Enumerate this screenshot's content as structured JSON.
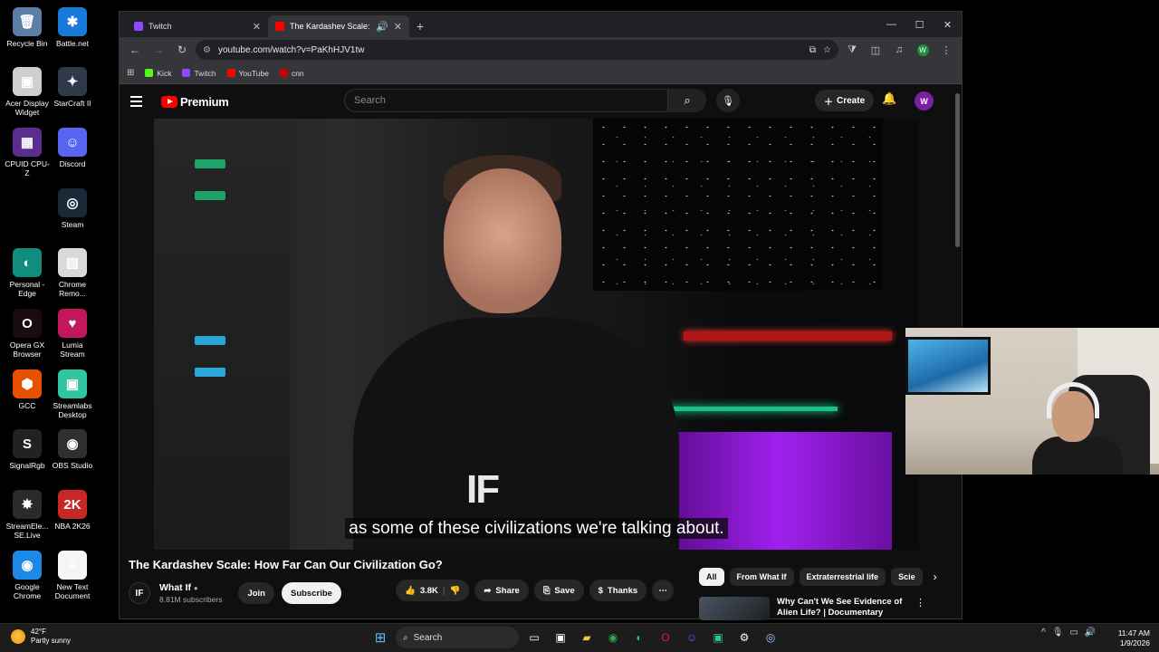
{
  "desktop": {
    "icons": [
      {
        "label": "Recycle Bin",
        "glyph": "🗑",
        "color": "#5a7ea6"
      },
      {
        "label": "Battle.net",
        "glyph": "✱",
        "color": "#1a7ad9"
      },
      {
        "label": "Acer Display Widget",
        "glyph": "▣",
        "color": "#cfcfcf"
      },
      {
        "label": "StarCraft II",
        "glyph": "✦",
        "color": "#2e3a4a"
      },
      {
        "label": "CPUID CPU-Z",
        "glyph": "▦",
        "color": "#5b2d91"
      },
      {
        "label": "Discord",
        "glyph": "☺",
        "color": "#5865f2"
      },
      {
        "label": "Steam",
        "glyph": "◎",
        "color": "#1b2838"
      },
      {
        "label": "Personal - Edge",
        "glyph": "◐",
        "color": "#0f8d7d"
      },
      {
        "label": "Chrome Remo...",
        "glyph": "▤",
        "color": "#d9d9d9"
      },
      {
        "label": "Opera GX Browser",
        "glyph": "O",
        "color": "#1a0a12"
      },
      {
        "label": "Lumia Stream",
        "glyph": "♥",
        "color": "#c2185b"
      },
      {
        "label": "GCC",
        "glyph": "⬢",
        "color": "#e65100"
      },
      {
        "label": "Streamlabs Desktop",
        "glyph": "▣",
        "color": "#31c3a2"
      },
      {
        "label": "SignalRgb",
        "glyph": "S",
        "color": "#222"
      },
      {
        "label": "OBS Studio",
        "glyph": "◉",
        "color": "#302e31"
      },
      {
        "label": "StreamEle... SE.Live",
        "glyph": "✸",
        "color": "#2a2a2a"
      },
      {
        "label": "NBA 2K26",
        "glyph": "2K",
        "color": "#c62828"
      },
      {
        "label": "Google Chrome",
        "glyph": "◉",
        "color": "#1e88e5"
      },
      {
        "label": "New Text Document",
        "glyph": "≡",
        "color": "#f5f5f5"
      }
    ]
  },
  "browser": {
    "tabs": [
      {
        "title": "Twitch",
        "fav_color": "#9146ff",
        "active": false
      },
      {
        "title": "The Kardashev Scale: How F",
        "fav_color": "#ff0000",
        "active": true
      }
    ],
    "url": "youtube.com/watch?v=PaKhHJV1tw",
    "bookmarks": [
      {
        "label": "Kick",
        "color": "#53fc18"
      },
      {
        "label": "Twitch",
        "color": "#9146ff"
      },
      {
        "label": "YouTube",
        "color": "#ff0000"
      },
      {
        "label": "cnn",
        "color": "#cc0000"
      }
    ],
    "profile_initial": "W"
  },
  "youtube": {
    "logo_text": "Premium",
    "search_placeholder": "Search",
    "create_label": "Create",
    "avatar_initial": "W",
    "caption": "as some of these civilizations we're talking about.",
    "video_title": "The Kardashev Scale: How Far Can Our Civilization Go?",
    "channel": {
      "name": "What If",
      "subscribers": "8.81M subscribers",
      "avatar_text": "IF"
    },
    "join_label": "Join",
    "subscribe_label": "Subscribe",
    "likes": "3.8K",
    "share_label": "Share",
    "save_label": "Save",
    "thanks_label": "Thanks",
    "chips": [
      "All",
      "From What If",
      "Extraterrestrial life",
      "Scie"
    ],
    "recommended": [
      {
        "title": "Why Can't We See Evidence of Alien Life? | Documentary"
      }
    ]
  },
  "taskbar": {
    "weather_temp": "42°F",
    "weather_desc": "Partly sunny",
    "search_label": "Search",
    "time": "11:47 AM",
    "date": "1/9/2026"
  }
}
